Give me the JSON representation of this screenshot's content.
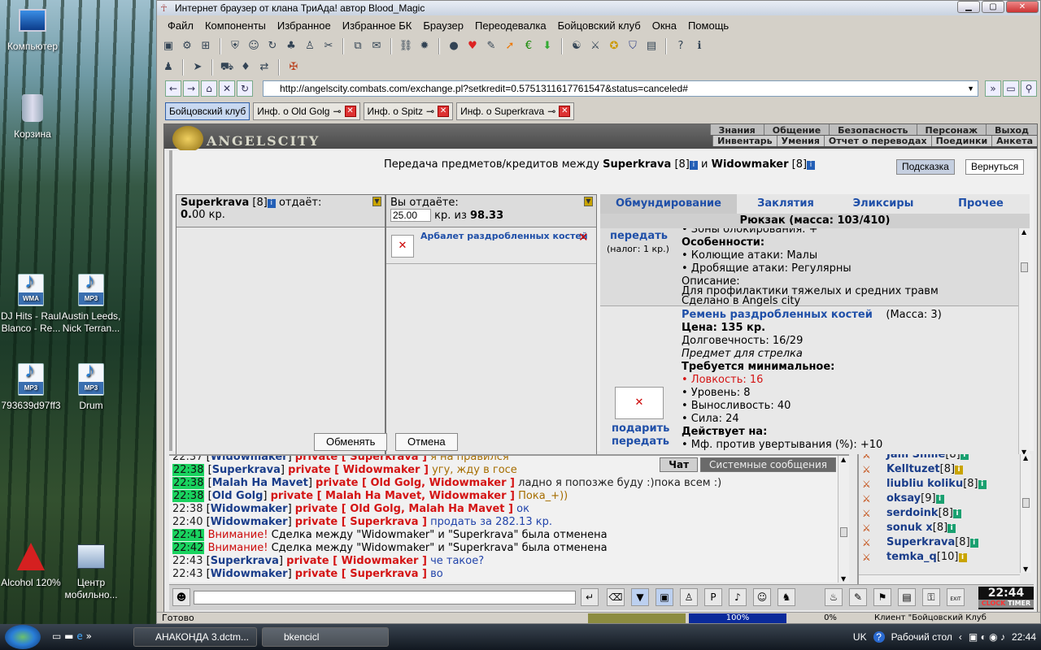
{
  "desktop": {
    "icons": [
      {
        "label": "Компьютер"
      },
      {
        "label": "Корзина"
      },
      {
        "label": "DJ Hits - Raul Blanco - Re...",
        "badge": "WMA"
      },
      {
        "label": "Austin Leeds, Nick Terran...",
        "badge": "MP3"
      },
      {
        "label": "793639d97ff3",
        "badge": "MP3"
      },
      {
        "label": "Drum",
        "badge": "MP3"
      },
      {
        "label": "Alcohol 120%"
      },
      {
        "label": "Центр мобильно..."
      }
    ]
  },
  "window": {
    "title": "Интернет браузер от клана ТриАда! автор Blood_Magic",
    "menu": [
      "Файл",
      "Компоненты",
      "Избранное",
      "Избранное БК",
      "Браузер",
      "Переодевалка",
      "Бойцовский клуб",
      "Окна",
      "Помощь"
    ],
    "url": "http://angelscity.combats.com/exchange.pl?setkredit=0.5751311617761547&status=canceled#",
    "tabs": [
      {
        "label": "Бойцовский клуб"
      },
      {
        "label": "Инф. о Old Golg"
      },
      {
        "label": "Инф. о Spitz"
      },
      {
        "label": "Инф. о Superkrava"
      }
    ],
    "status": "Готово",
    "status_progress": "100%",
    "status_zero": "0%",
    "status_client": "Клиент \"Бойцовский Клуб"
  },
  "site": {
    "logo": "ANGELSCITY",
    "topnav": [
      "Знания",
      "Общение",
      "Безопасность",
      "Персонаж",
      "Выход"
    ],
    "subnav": [
      "Инвентарь",
      "Умения",
      "Отчет о переводах",
      "Поединки",
      "Анкета"
    ],
    "heading_prefix": "Передача предметов/кредитов между",
    "player1": "Superkrava",
    "player1_level": "[8]",
    "heading_and": "и",
    "player2": "Widowmaker",
    "player2_level": "[8]",
    "hint_btn": "Подсказка",
    "back_btn": "Вернуться",
    "left_panel": {
      "name": "Superkrava",
      "level": "[8]",
      "gives": "отдаёт:",
      "amount": "0.00",
      "amount_bold": "0.",
      "amount_rest": "00 кр."
    },
    "mid_panel": {
      "you_give": "Вы отдаёте:",
      "credit_value": "25.00",
      "of_text": "кр. из",
      "total": "98.33",
      "item_name": "Арбалет раздробленных костей"
    },
    "exchange_btn": "Обменять",
    "cancel_btn": "Отмена",
    "inv_tabs": [
      "Обмундирование",
      "Заклятия",
      "Эликсиры",
      "Прочее"
    ],
    "rucksack": "Рюкзак (масса: 103/410)",
    "item1": {
      "action": "передать",
      "tax": "(налог: 1 кр.)",
      "line_zones": "• Зоны блокирования: +",
      "features_title": "Особенности:",
      "feat1": "• Колющие атаки: Малы",
      "feat2": "• Дробящие атаки: Регулярны",
      "desc_title": "Описание:",
      "desc1": "Для профилактики тяжелых и средних травм",
      "desc2": "Сделано в Angels city"
    },
    "item2": {
      "name": "Ремень раздробленных костей",
      "mass": "(Масса: 3)",
      "price": "Цена: 135 кр.",
      "durability": "Долговечность: 16/29",
      "for": "Предмет для стрелка",
      "req_title": "Требуется минимальное:",
      "req1": "• Ловкость: 16",
      "req2": "• Уровень: 8",
      "req3": "• Выносливость: 40",
      "req4": "• Сила: 24",
      "acts_title": "Действует на:",
      "act1": "• Мф. против увертывания (%): +10",
      "gift": "подарить",
      "give": "передать"
    }
  },
  "chat": {
    "tabs": [
      "Чат",
      "Системные сообщения"
    ],
    "lines": [
      {
        "time": "22:37",
        "from": "Widowmaker",
        "private": "private [ Superkrava ]",
        "text": "я на правился"
      },
      {
        "time": "22:38",
        "from": "Superkrava",
        "private": "private [ Widowmaker ]",
        "text": "угу, жду в госе"
      },
      {
        "time": "22:38",
        "from": "Malah Ha Mavet",
        "private": "private [ Old Golg, Widowmaker ]",
        "text": "ладно я попозже буду :)пока всем :)"
      },
      {
        "time": "22:38",
        "from": "Old Golg",
        "private": "private [ Malah Ha Mavet, Widowmaker ]",
        "text": "Пока_+))"
      },
      {
        "time": "22:38",
        "from": "Widowmaker",
        "private": "private [ Old Golg, Malah Ha Mavet ]",
        "text": "ок"
      },
      {
        "time": "22:40",
        "from": "Widowmaker",
        "private": "private [ Superkrava ]",
        "text": "продать за 282.13 кр."
      },
      {
        "time": "22:41",
        "warn": "Внимание!",
        "text": "Сделка между \"Widowmaker\" и \"Superkrava\" была отменена"
      },
      {
        "time": "22:42",
        "warn": "Внимание!",
        "text": "Сделка между \"Widowmaker\" и \"Superkrava\" была отменена"
      },
      {
        "time": "22:43",
        "from": "Superkrava",
        "private": "private [ Widowmaker ]",
        "text": "че такое?"
      },
      {
        "time": "22:43",
        "from": "Widowmaker",
        "private": "private [ Superkrava ]",
        "text": "во"
      }
    ]
  },
  "users": [
    {
      "name": "Jam Smile",
      "level": "[8]"
    },
    {
      "name": "Kelltuzet",
      "level": "[8]"
    },
    {
      "name": "liubliu koliku",
      "level": "[8]"
    },
    {
      "name": "oksay",
      "level": "[9]"
    },
    {
      "name": "serdoink",
      "level": "[8]"
    },
    {
      "name": "sonuk x",
      "level": "[8]"
    },
    {
      "name": "Superkrava",
      "level": "[8]"
    },
    {
      "name": "temka_q",
      "level": "[10]"
    }
  ],
  "clock": {
    "time": "22:44",
    "label_clock": "CLOCK",
    "label_timer": "TIMER",
    "label_exit": "EXIT"
  },
  "taskbar": {
    "items": [
      "АНАКОНДА 3.dctm...",
      "bkencicl"
    ],
    "lang": "UK",
    "desktop_label": "Рабочий стол",
    "time": "22:44"
  }
}
